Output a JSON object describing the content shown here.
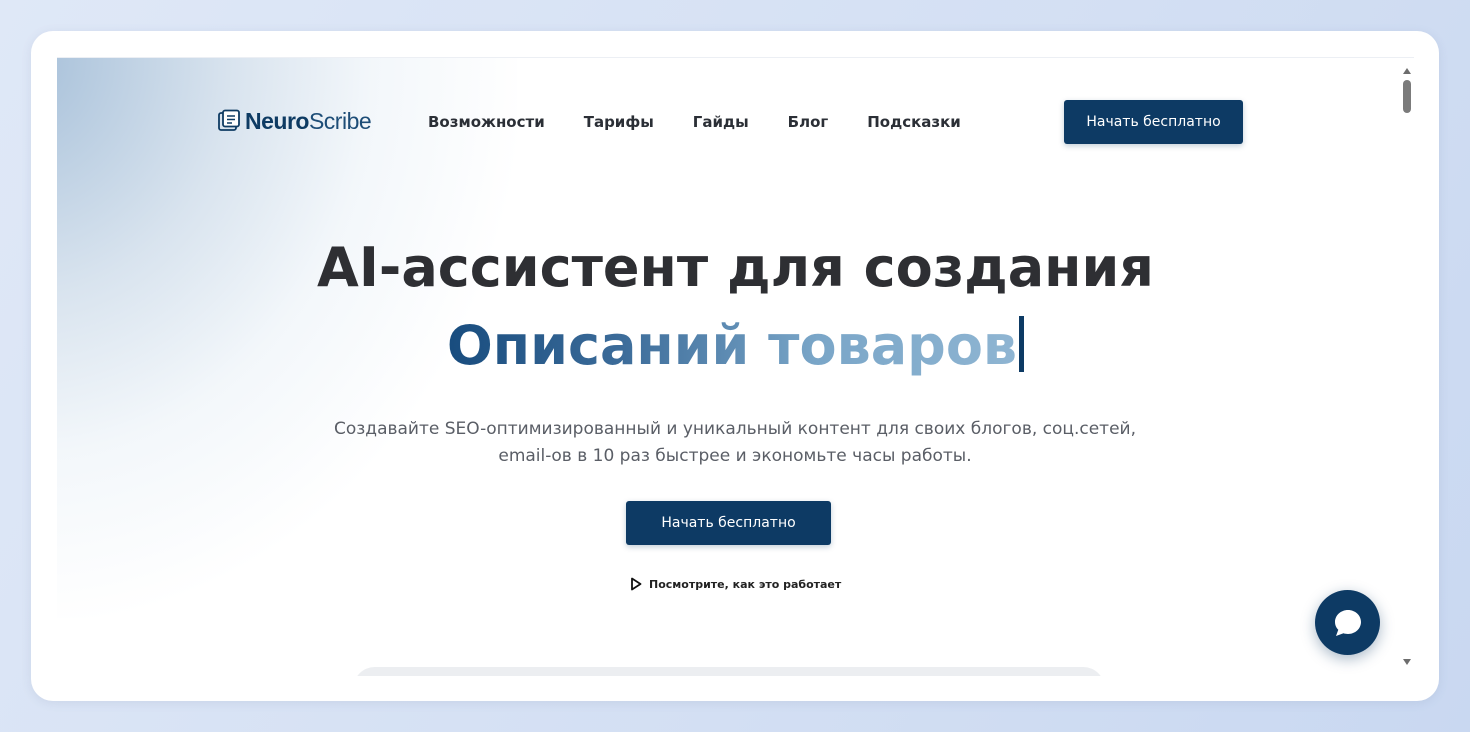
{
  "brand": {
    "name_bold": "Neuro",
    "name_light": "Scribe",
    "color": "#0e3b63",
    "icon": "document-stack-icon"
  },
  "nav": {
    "links": [
      "Возможности",
      "Тарифы",
      "Гайды",
      "Блог",
      "Подсказки"
    ],
    "cta_label": "Начать бесплатно"
  },
  "hero": {
    "title": "AI-ассистент для создания",
    "typed_text": "Описаний товаров",
    "subtitle_line1": "Создавайте SEO-оптимизированный и уникальный контент для своих блогов, соц.сетей,",
    "subtitle_line2": "email-ов в 10 раз быстрее и экономьте часы работы.",
    "cta_label": "Начать бесплатно",
    "watch_label": "Посмотрите, как это работает"
  },
  "colors": {
    "primary": "#0d3a64",
    "heading": "#2e2f33",
    "subtitle": "#5a5e66",
    "background": "#dfe8f7"
  },
  "icons": {
    "play": "play-icon",
    "chat": "chat-bubble-icon"
  }
}
